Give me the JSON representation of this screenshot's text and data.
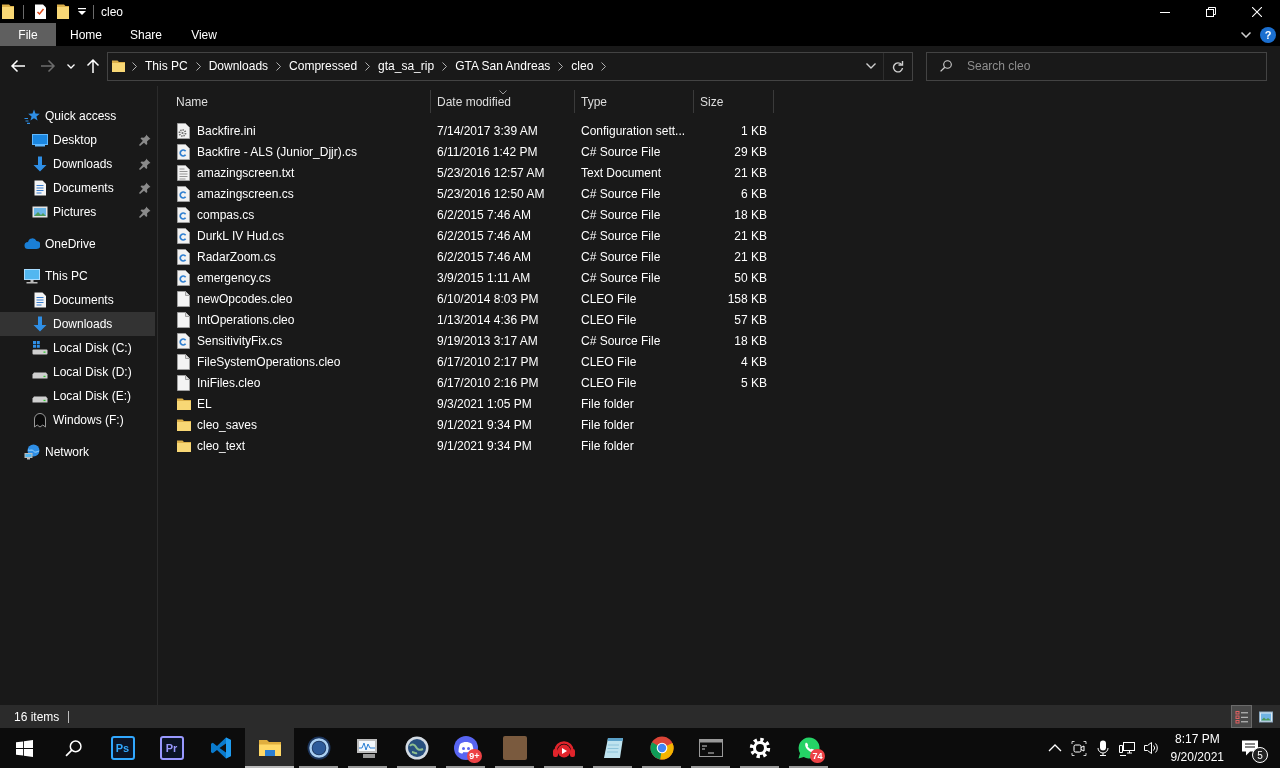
{
  "title_bar": {
    "title": "cleo"
  },
  "ribbon": {
    "tabs": [
      {
        "label": "File",
        "selected": true
      },
      {
        "label": "Home",
        "selected": false
      },
      {
        "label": "Share",
        "selected": false
      },
      {
        "label": "View",
        "selected": false
      }
    ],
    "help": "?"
  },
  "navigation": [
    {
      "kind": "back",
      "disabled": false
    },
    {
      "kind": "forward",
      "disabled": true
    },
    {
      "kind": "recent",
      "disabled": false
    },
    {
      "kind": "up",
      "disabled": false
    }
  ],
  "address_bar": {
    "breadcrumbs": [
      "This PC",
      "Downloads",
      "Compressed",
      "gta_sa_rip",
      "GTA San Andreas",
      "cleo"
    ]
  },
  "search": {
    "placeholder": "Search cleo"
  },
  "sidebar": {
    "items": [
      {
        "label": "Quick access",
        "kind": "quick-access",
        "selected": false,
        "children": [
          {
            "label": "Desktop",
            "kind": "desktop",
            "selected": false,
            "pinned": true
          },
          {
            "label": "Downloads",
            "kind": "downloads",
            "selected": false,
            "pinned": true
          },
          {
            "label": "Documents",
            "kind": "documents",
            "selected": false,
            "pinned": true
          },
          {
            "label": "Pictures",
            "kind": "pictures",
            "selected": false,
            "pinned": true
          }
        ]
      },
      {
        "label": "OneDrive",
        "kind": "cloud",
        "selected": false
      },
      {
        "label": "This PC",
        "kind": "computer",
        "selected": false,
        "children": [
          {
            "label": "Documents",
            "kind": "documents",
            "selected": false,
            "pinned": false
          },
          {
            "label": "Downloads",
            "kind": "downloads",
            "selected": true,
            "pinned": false
          },
          {
            "label": "Local Disk (C:)",
            "kind": "system-drive",
            "selected": false,
            "pinned": false
          },
          {
            "label": "Local Disk (D:)",
            "kind": "drive",
            "selected": false,
            "pinned": false
          },
          {
            "label": "Local Disk (E:)",
            "kind": "drive",
            "selected": false,
            "pinned": false
          },
          {
            "label": "Windows (F:)",
            "kind": "custom-drive",
            "selected": false,
            "pinned": false
          }
        ]
      },
      {
        "label": "Network",
        "kind": "network",
        "selected": false
      }
    ]
  },
  "table": {
    "columns": [
      {
        "label": "Name",
        "sorted": false
      },
      {
        "label": "Date modified",
        "sorted": true
      },
      {
        "label": "Type",
        "sorted": false
      },
      {
        "label": "Size",
        "sorted": false
      }
    ],
    "rows": [
      {
        "kind": "settings",
        "name": "Backfire.ini",
        "date": "7/14/2017 3:39 AM",
        "type": "Configuration sett...",
        "size": "1 KB"
      },
      {
        "kind": "code",
        "name": "Backfire - ALS (Junior_Djjr).cs",
        "date": "6/11/2016 1:42 PM",
        "type": "C# Source File",
        "size": "29 KB"
      },
      {
        "kind": "text",
        "name": "amazingscreen.txt",
        "date": "5/23/2016 12:57 AM",
        "type": "Text Document",
        "size": "21 KB"
      },
      {
        "kind": "code",
        "name": "amazingscreen.cs",
        "date": "5/23/2016 12:50 AM",
        "type": "C# Source File",
        "size": "6 KB"
      },
      {
        "kind": "code",
        "name": "compas.cs",
        "date": "6/2/2015 7:46 AM",
        "type": "C# Source File",
        "size": "18 KB"
      },
      {
        "kind": "code",
        "name": "DurkL IV Hud.cs",
        "date": "6/2/2015 7:46 AM",
        "type": "C# Source File",
        "size": "21 KB"
      },
      {
        "kind": "code",
        "name": "RadarZoom.cs",
        "date": "6/2/2015 7:46 AM",
        "type": "C# Source File",
        "size": "21 KB"
      },
      {
        "kind": "code",
        "name": "emergency.cs",
        "date": "3/9/2015 1:11 AM",
        "type": "C# Source File",
        "size": "50 KB"
      },
      {
        "kind": "blank",
        "name": "newOpcodes.cleo",
        "date": "6/10/2014 8:03 PM",
        "type": "CLEO File",
        "size": "158 KB"
      },
      {
        "kind": "blank",
        "name": "IntOperations.cleo",
        "date": "1/13/2014 4:36 PM",
        "type": "CLEO File",
        "size": "57 KB"
      },
      {
        "kind": "code",
        "name": "SensitivityFix.cs",
        "date": "9/19/2013 3:17 AM",
        "type": "C# Source File",
        "size": "18 KB"
      },
      {
        "kind": "blank",
        "name": "FileSystemOperations.cleo",
        "date": "6/17/2010 2:17 PM",
        "type": "CLEO File",
        "size": "4 KB"
      },
      {
        "kind": "blank",
        "name": "IniFiles.cleo",
        "date": "6/17/2010 2:16 PM",
        "type": "CLEO File",
        "size": "5 KB"
      },
      {
        "kind": "folder",
        "name": "EL",
        "date": "9/3/2021 1:05 PM",
        "type": "File folder"
      },
      {
        "kind": "folder",
        "name": "cleo_saves",
        "date": "9/1/2021 9:34 PM",
        "type": "File folder"
      },
      {
        "kind": "folder",
        "name": "cleo_text",
        "date": "9/1/2021 9:34 PM",
        "type": "File folder"
      }
    ]
  },
  "status_bar": {
    "item_count": "16 items",
    "views": [
      {
        "kind": "details",
        "selected": true
      },
      {
        "kind": "large-icons",
        "selected": false
      }
    ]
  },
  "taskbar": {
    "apps": [
      {
        "kind": "start",
        "running": false,
        "active": false
      },
      {
        "kind": "search",
        "running": false,
        "active": false
      },
      {
        "kind": "tile",
        "label": "Ps",
        "color": "#31a8ff",
        "running": false,
        "active": false
      },
      {
        "kind": "tile",
        "label": "Pr",
        "color": "#9999ff",
        "running": false,
        "active": false
      },
      {
        "kind": "code-editor",
        "running": false,
        "active": false
      },
      {
        "kind": "folder",
        "running": true,
        "active": true
      },
      {
        "kind": "ring",
        "running": true,
        "active": false
      },
      {
        "kind": "monitor",
        "running": true,
        "active": false
      },
      {
        "kind": "globe",
        "running": true,
        "active": false
      },
      {
        "kind": "chat",
        "badge": "9+",
        "running": true,
        "active": false
      },
      {
        "kind": "photo",
        "running": true,
        "active": false
      },
      {
        "kind": "player",
        "running": true,
        "active": false
      },
      {
        "kind": "notepad",
        "running": true,
        "active": false
      },
      {
        "kind": "browser",
        "running": true,
        "active": false
      },
      {
        "kind": "terminal",
        "running": true,
        "active": false
      },
      {
        "kind": "gear",
        "running": true,
        "active": false
      },
      {
        "kind": "messenger",
        "badge": "74",
        "running": true,
        "active": false
      }
    ],
    "clock": {
      "time": "8:17 PM",
      "date": "9/20/2021"
    },
    "notifications": {
      "badge": "5"
    }
  }
}
